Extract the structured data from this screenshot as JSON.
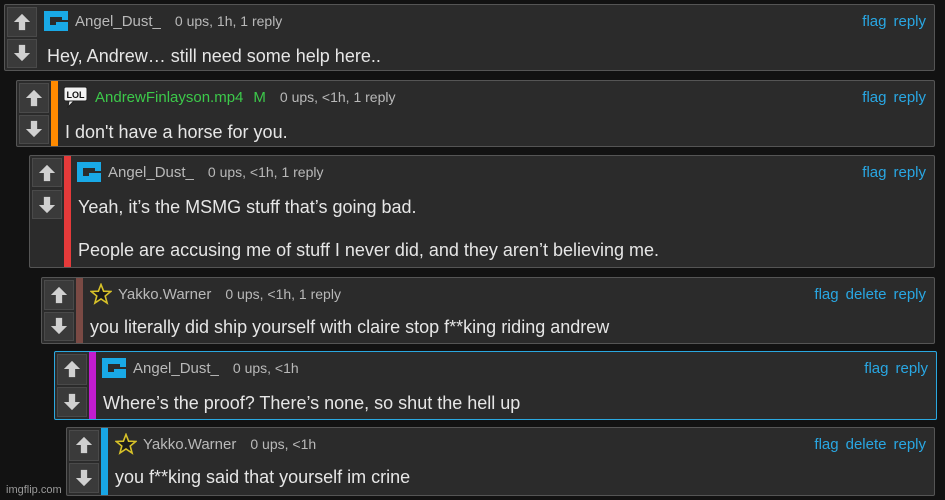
{
  "brand": "imgflip.com",
  "colors": {
    "link": "#29a7e3",
    "mod_green": "#3cc94a",
    "stripe_orange": "#ff8a00",
    "stripe_red": "#e53a3a",
    "stripe_brown": "#7a4a44",
    "stripe_magenta": "#c21ccf",
    "stripe_blue": "#18a6e5"
  },
  "comments": [
    {
      "username": "Angel_Dust_",
      "meta": "0 ups, 1h, 1 reply",
      "icon": "blue-bracket-avatar-icon",
      "actions": [
        "flag",
        "reply"
      ],
      "lines": [
        "Hey, Andrew… still need some help here.."
      ]
    },
    {
      "username": "AndrewFinlayson.mp4",
      "badge": "M",
      "meta": "0 ups, <1h, 1 reply",
      "icon": "lol-speech-bubble-icon",
      "icon_text": "LOL",
      "actions": [
        "flag",
        "reply"
      ],
      "lines": [
        "I don't have a horse for you."
      ]
    },
    {
      "username": "Angel_Dust_",
      "meta": "0 ups, <1h, 1 reply",
      "icon": "blue-bracket-avatar-icon",
      "actions": [
        "flag",
        "reply"
      ],
      "lines": [
        "Yeah, it’s the MSMG stuff that’s going bad.",
        "People are accusing me of stuff I never did, and they aren’t believing me."
      ]
    },
    {
      "username": "Yakko.Warner",
      "meta": "0 ups, <1h, 1 reply",
      "icon": "star-icon",
      "actions": [
        "flag",
        "delete",
        "reply"
      ],
      "lines": [
        "you literally did ship yourself with claire stop f**king riding andrew"
      ]
    },
    {
      "username": "Angel_Dust_",
      "meta": "0 ups, <1h",
      "icon": "blue-bracket-avatar-icon",
      "actions": [
        "flag",
        "reply"
      ],
      "lines": [
        "Where’s the proof? There’s none, so shut the hell up"
      ]
    },
    {
      "username": "Yakko.Warner",
      "meta": "0 ups, <1h",
      "icon": "star-icon",
      "actions": [
        "flag",
        "delete",
        "reply"
      ],
      "lines": [
        "you f**king said that yourself im crine"
      ]
    }
  ]
}
